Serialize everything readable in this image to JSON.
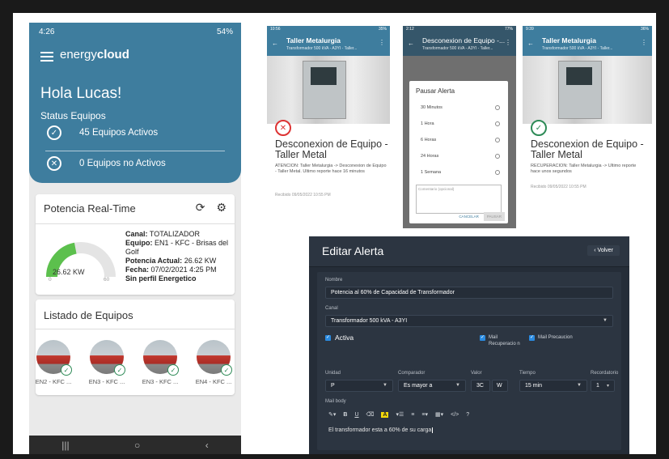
{
  "phone": {
    "status_time": "4:26",
    "status_right": "54%",
    "logo_light": "energy",
    "logo_bold": "cloud",
    "greeting": "Hola Lucas!",
    "status_title": "Status Equipos",
    "active_text": "45 Equipos Activos",
    "inactive_text": "0 Equipos no Activos",
    "power_title": "Potencia Real-Time",
    "gauge_value": "26.62 KW",
    "gauge_min": "0",
    "gauge_max": "60",
    "gauge_fraction": 0.44,
    "info": {
      "canal_label": "Canal:",
      "canal": "TOTALIZADOR",
      "equipo_label": "Equipo:",
      "equipo": "EN1 - KFC - Brisas del Golf",
      "potencia_label": "Potencia Actual:",
      "potencia": "26.62 KW",
      "fecha_label": "Fecha:",
      "fecha": "07/02/2021 4:25 PM",
      "perfil": "Sin perfil Energetico"
    },
    "list_title": "Listado de Equipos",
    "equipos": [
      "EN2 - KFC ...",
      "EN3 - KFC ...",
      "EN3 - KFC ...",
      "EN4 - KFC ..."
    ]
  },
  "shot1": {
    "status_time": "10:56",
    "status_right": "35%",
    "title": "Taller Metalurgia",
    "subtitle": "Transformador 500 kVA - A3YI - Taller...",
    "alert_title": "Desconexion de Equipo - Taller Metal",
    "message": "ATENCION: Taller Metalurgia -> Desconexion de Equipo - Taller Metal. Ultimo reporte hace 16 minutos",
    "date": "Recibido 09/05/2022 10:55 PM"
  },
  "shot2": {
    "status_time": "2:12",
    "status_right": "77%",
    "title": "Desconexion de Equipo -...",
    "subtitle": "Transformador 500 kVA - A3YI - Taller...",
    "dialog_title": "Pausar Alerta",
    "options": [
      "30 Minutos",
      "1 Hora",
      "6 Horas",
      "24 Horas",
      "1 Semana"
    ],
    "comment_placeholder": "Comentario (opcional)",
    "cancel": "CANCELAR",
    "ok": "PAUSAR"
  },
  "shot3": {
    "status_time": "9:39",
    "status_right": "36%",
    "title": "Taller Metalurgia",
    "subtitle": "Transformador 500 kVA - A3YI - Taller...",
    "alert_title": "Desconexion de Equipo - Taller Metal",
    "message": "RECUPERACION: Taller Metalurgia -> Ultimo reporte hace unos segundos",
    "date": "Recibido 09/05/2022 10:55 PM"
  },
  "editor": {
    "title": "Editar Alerta",
    "back": "Volver",
    "nombre_label": "Nombre",
    "nombre": "Potencia al 60% de Capacidad de Transformador",
    "canal_label": "Canal",
    "canal": "Transformador 500 kVA - A3YI",
    "activa": "Activa",
    "mail_recup": "Mail Recuperacio n",
    "mail_prec": "Mail Precaucion",
    "unidad_label": "Unidad",
    "unidad": "P",
    "comparador_label": "Comparador",
    "comparador": "Es mayor a",
    "valor_label": "Valor",
    "valor": "3C",
    "valor_unit": "W",
    "tiempo_label": "Tiempo",
    "tiempo": "15 min",
    "recordatorio_label": "Recordatorio",
    "recordatorio": "1",
    "mailbody_label": "Mail body",
    "mailbody": "El transformador esta a 60% de su carga"
  }
}
